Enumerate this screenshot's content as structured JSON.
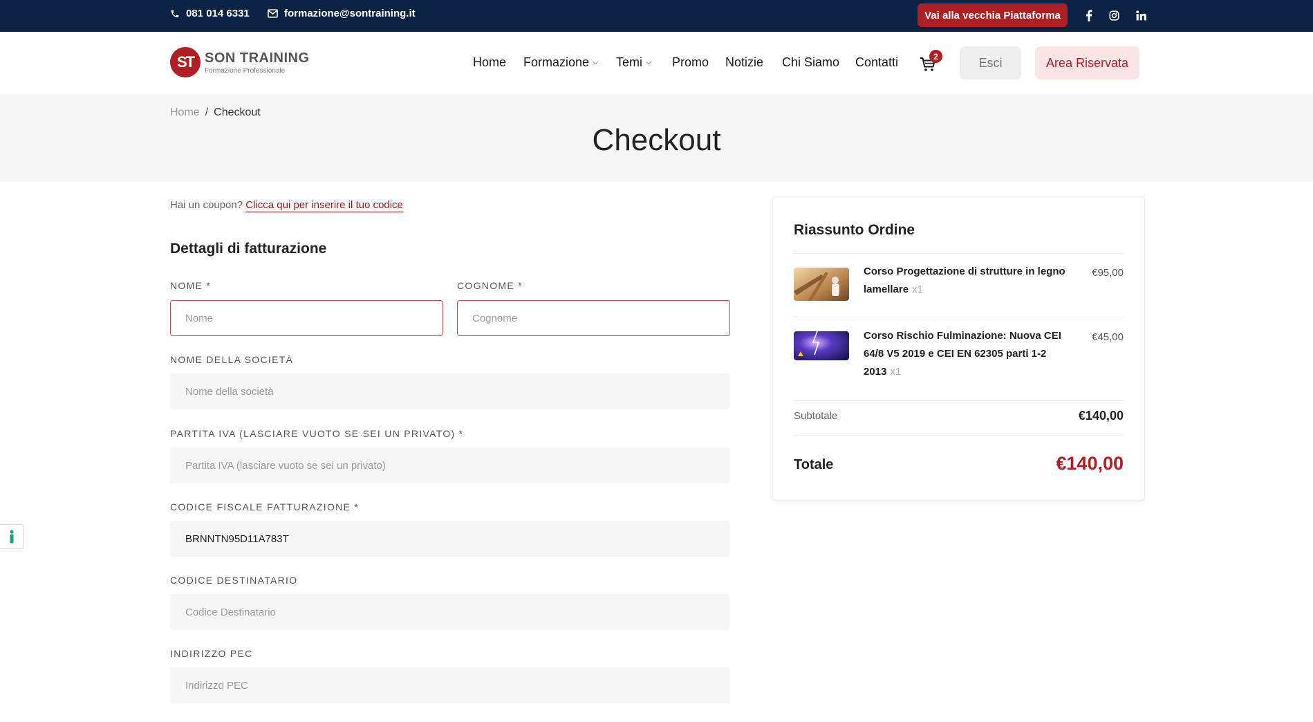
{
  "topbar": {
    "phone": "081 014 6331",
    "email": "formazione@sontraining.it",
    "old_platform_label": "Vai alla vecchia Piattaforma",
    "social": [
      "facebook-icon",
      "instagram-icon",
      "linkedin-icon"
    ]
  },
  "header": {
    "logo_title": "SON TRAINING",
    "logo_subtitle": "Formazione Professionale",
    "logo_mark": "ST",
    "nav": [
      "Home",
      "Formazione",
      "Temi",
      "Promo",
      "Notizie",
      "Chi Siamo",
      "Contatti"
    ],
    "cart_count": "2",
    "logout_label": "Esci",
    "reserved_label": "Area Riservata"
  },
  "breadcrumb": {
    "home": "Home",
    "separator": "/",
    "current": "Checkout"
  },
  "page_title": "Checkout",
  "coupon": {
    "text": "Hai un coupon?",
    "link": "Clicca qui per inserire il tuo codice"
  },
  "billing": {
    "title": "Dettagli di fatturazione",
    "fields": {
      "nome": {
        "label": "NOME *",
        "placeholder": "Nome",
        "value": ""
      },
      "cognome": {
        "label": "COGNOME *",
        "placeholder": "Cognome",
        "value": ""
      },
      "societa": {
        "label": "NOME DELLA SOCIETÀ",
        "placeholder": "Nome della società",
        "value": ""
      },
      "piva": {
        "label": "PARTITA IVA (LASCIARE VUOTO SE SEI UN PRIVATO) *",
        "placeholder": "Partita IVA (lasciare vuoto se sei un privato)",
        "value": ""
      },
      "cf": {
        "label": "CODICE FISCALE FATTURAZIONE *",
        "placeholder": "",
        "value": "BRNNTN95D11A783T"
      },
      "destinatario": {
        "label": "CODICE DESTINATARIO",
        "placeholder": "Codice Destinatario",
        "value": ""
      },
      "pec": {
        "label": "INDIRIZZO PEC",
        "placeholder": "Indirizzo PEC",
        "value": ""
      }
    }
  },
  "summary": {
    "title": "Riassunto Ordine",
    "items": [
      {
        "name": "Corso Progettazione di strutture in legno lamellare",
        "qty": "x1",
        "price": "€95,00"
      },
      {
        "name": "Corso Rischio Fulminazione: Nuova CEI 64/8 V5 2019 e CEI EN 62305 parti 1-2 2013",
        "qty": "x1",
        "price": "€45,00"
      }
    ],
    "subtotal_label": "Subtotale",
    "subtotal_value": "€140,00",
    "total_label": "Totale",
    "total_value": "€140,00"
  },
  "colors": {
    "navy": "#0b2244",
    "brand_red": "#b01f24",
    "pink_bg": "#fbe4e5"
  }
}
